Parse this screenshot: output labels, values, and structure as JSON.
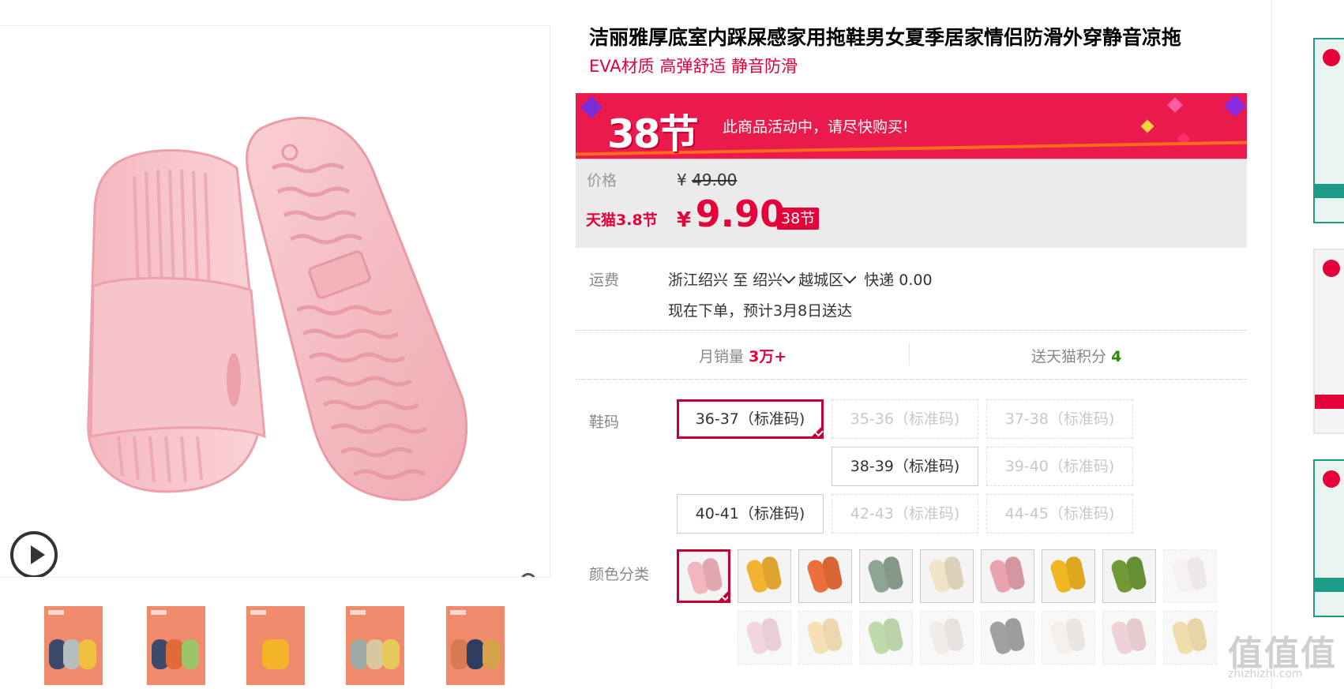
{
  "product": {
    "title": "洁丽雅厚底室内踩屎感家用拖鞋男女夏季居家情侣防滑外穿静音凉拖",
    "subtitle": "EVA材质 高弹舒适 静音防滑"
  },
  "promo": {
    "event": "38节",
    "message": "此商品活动中，请尽快购买!"
  },
  "price": {
    "label": "价格",
    "currency": "¥",
    "original": "49.00",
    "promo_label": "天猫3.8节",
    "sale": "9.90",
    "badge": "38节"
  },
  "shipping": {
    "label": "运费",
    "from": "浙江绍兴",
    "to_word": "至",
    "city": "绍兴",
    "district": "越城区",
    "method": "快递 0.00",
    "delivery": "现在下单，预计3月8日送达"
  },
  "stats": {
    "monthly_sales_label": "月销量",
    "monthly_sales_value": "3万+",
    "points_label": "送天猫积分",
    "points_value": "4"
  },
  "sizes": {
    "label": "鞋码",
    "options": [
      {
        "label": "36-37（标准码)",
        "state": "selected"
      },
      {
        "label": "35-36（标准码)",
        "state": "disabled"
      },
      {
        "label": "37-38（标准码)",
        "state": "disabled"
      },
      {
        "label": "38-39（标准码)",
        "state": "available"
      },
      {
        "label": "39-40（标准码)",
        "state": "disabled"
      },
      {
        "label": "40-41（标准码)",
        "state": "available"
      },
      {
        "label": "42-43（标准码)",
        "state": "disabled"
      },
      {
        "label": "44-45（标准码)",
        "state": "disabled"
      }
    ]
  },
  "colors": {
    "label": "颜色分类",
    "swatches": [
      {
        "color": "#f4b6bd",
        "state": "selected"
      },
      {
        "color": "#f2b233",
        "state": "available"
      },
      {
        "color": "#ec6e3a",
        "state": "available"
      },
      {
        "color": "#8fa593",
        "state": "available"
      },
      {
        "color": "#efe3c8",
        "state": "available"
      },
      {
        "color": "#e8a3ae",
        "state": "available"
      },
      {
        "color": "#f0b723",
        "state": "available"
      },
      {
        "color": "#6f9a36",
        "state": "available"
      },
      {
        "color": "#efe9e6",
        "state": "disabled"
      },
      {
        "color": "#e6b8c3",
        "state": "disabled"
      },
      {
        "color": "#f0c77a",
        "state": "disabled"
      },
      {
        "color": "#8bbd68",
        "state": "disabled"
      },
      {
        "color": "#e4ded8",
        "state": "disabled"
      },
      {
        "color": "#555555",
        "state": "disabled"
      },
      {
        "color": "#ece2dc",
        "state": "disabled"
      },
      {
        "color": "#e2aeb8",
        "state": "disabled"
      },
      {
        "color": "#e6c36a",
        "state": "disabled"
      }
    ]
  },
  "watermark": {
    "text": "值值值",
    "url": "zhizhizhi.com"
  },
  "theme": {
    "accent": "#e5003a",
    "banner": "#ea1a4c",
    "product_pink": "#f6bcc1"
  }
}
